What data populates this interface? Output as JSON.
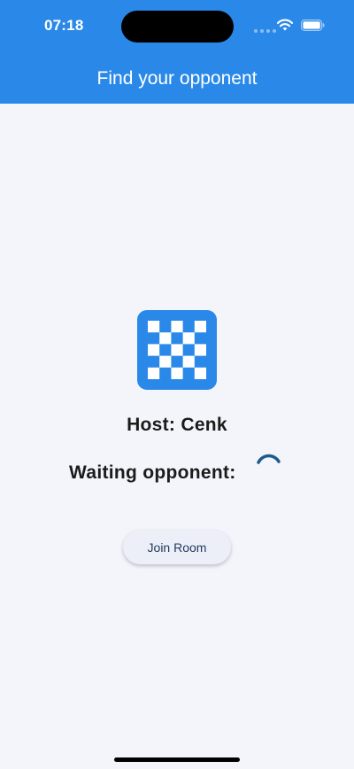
{
  "status_bar": {
    "time": "07:18",
    "icons": [
      "signal-dots-icon",
      "wifi-icon",
      "battery-icon"
    ]
  },
  "header": {
    "title": "Find your opponent",
    "background_color": "#2a89e8"
  },
  "main": {
    "board_icon": "checkerboard-icon",
    "host_text": "Host: Cenk",
    "waiting_text": "Waiting opponent:",
    "loading_indicator": "loading-spinner",
    "join_button_label": "Join Room"
  },
  "colors": {
    "accent": "#2a89e8",
    "spinner": "#1e5a8c",
    "background": "#f4f5fb",
    "button_bg": "#eceef8",
    "button_text": "#1f3a5c"
  }
}
